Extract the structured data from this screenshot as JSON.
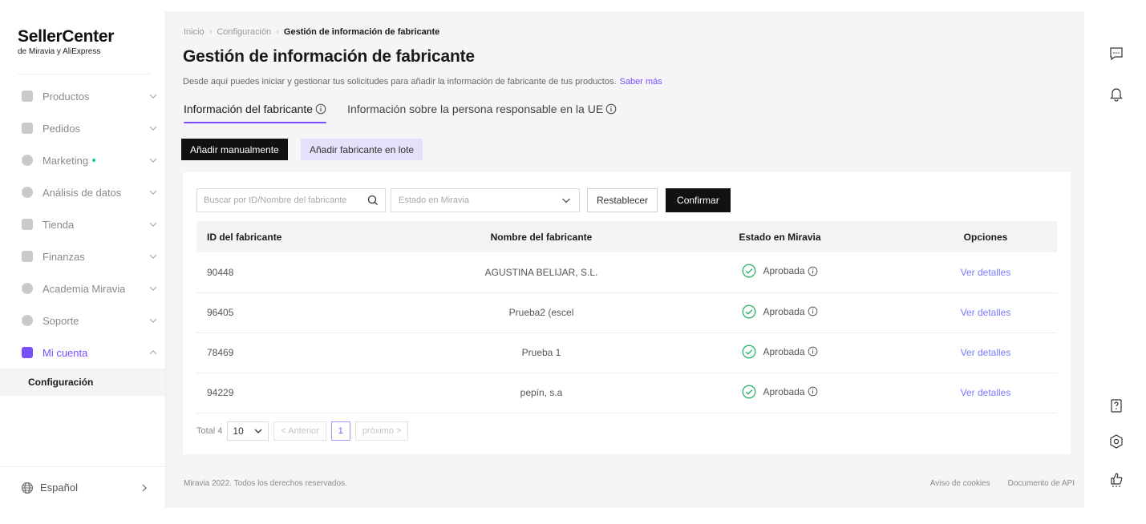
{
  "brand": {
    "title": "SellerCenter",
    "subtitle": "de Miravia y AliExpress"
  },
  "sidebar": {
    "items": [
      {
        "label": "Productos",
        "icon": "box-icon"
      },
      {
        "label": "Pedidos",
        "icon": "order-icon"
      },
      {
        "label": "Marketing",
        "icon": "marketing-icon"
      },
      {
        "label": "Análisis de datos",
        "icon": "analytics-icon"
      },
      {
        "label": "Tienda",
        "icon": "store-icon"
      },
      {
        "label": "Finanzas",
        "icon": "finance-icon"
      },
      {
        "label": "Academia Miravia",
        "icon": "academy-icon"
      },
      {
        "label": "Soporte",
        "icon": "support-icon"
      },
      {
        "label": "Mi cuenta",
        "icon": "account-icon"
      }
    ],
    "sub_item": "Configuración",
    "language": "Español"
  },
  "breadcrumb": {
    "home": "Inicio",
    "parent": "Configuración",
    "current": "Gestión de información de fabricante"
  },
  "page": {
    "title": "Gestión de información de fabricante",
    "description": "Desde aquí puedes iniciar y gestionar tus solicitudes para añadir la información de fabricante de tus productos.",
    "learn_more": "Saber más"
  },
  "tabs": [
    {
      "label": "Información del fabricante",
      "active": true
    },
    {
      "label": "Información sobre la persona responsable en la UE",
      "active": false
    }
  ],
  "actions": {
    "add_manual": "Añadir manualmente",
    "add_batch": "Añadir fabricante en lote"
  },
  "filters": {
    "search_placeholder": "Buscar por ID/Nombre del fabricante",
    "status_placeholder": "Estado en Miravia",
    "reset": "Restablecer",
    "confirm": "Confirmar"
  },
  "table": {
    "columns": [
      "ID del fabricante",
      "Nombre del fabricante",
      "Estado en Miravia",
      "Opciones"
    ],
    "rows": [
      {
        "id": "90448",
        "name": "AGUSTINA BELIJAR, S.L.",
        "status": "Aprobada",
        "option": "Ver detalles"
      },
      {
        "id": "96405",
        "name": "Prueba2 (escel",
        "status": "Aprobada",
        "option": "Ver detalles"
      },
      {
        "id": "78469",
        "name": "Prueba 1",
        "status": "Aprobada",
        "option": "Ver detalles"
      },
      {
        "id": "94229",
        "name": "pepín, s.a",
        "status": "Aprobada",
        "option": "Ver detalles"
      }
    ]
  },
  "pagination": {
    "total": "Total 4",
    "page_size": "10",
    "prev": "< Anterior",
    "current": "1",
    "next": "próximo >"
  },
  "footer": {
    "copyright": "Miravia 2022. Todos los derechos reservados.",
    "cookies": "Aviso de cookies",
    "api": "Documento de API"
  },
  "colors": {
    "accent": "#7a4dff",
    "success": "#2fb36b",
    "dark": "#111111"
  }
}
